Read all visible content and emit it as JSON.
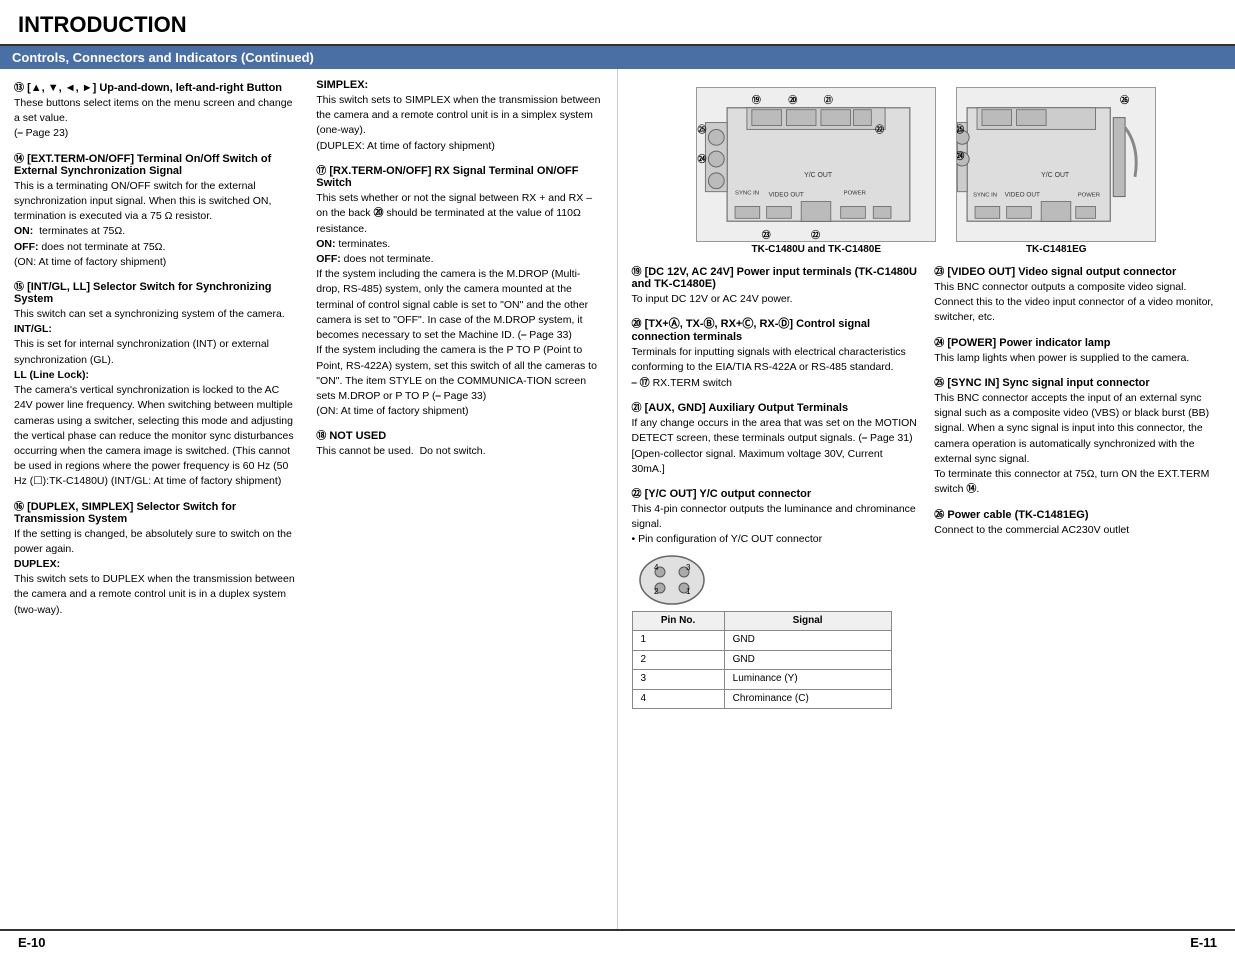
{
  "page": {
    "title": "INTRODUCTION",
    "section_header": "Controls, Connectors and Indicators (Continued)",
    "footer_left": "E-10",
    "footer_right": "E-11"
  },
  "left_column": {
    "entries": [
      {
        "id": "entry_13",
        "num": "⑬",
        "title": "[🔼, 🔽, ◀, ▶] Up-and-down, left-and-right Button",
        "body": "These buttons select items on the menu screen and change a set value.\n(☞ Page 23)"
      },
      {
        "id": "entry_14",
        "num": "⑭",
        "title": "[EXT.TERM-ON/OFF] Terminal On/Off Switch of External Synchronization Signal",
        "body": "This is a terminating ON/OFF switch for the external synchronization input signal. When this is switched ON, termination is executed via a 75 Ω resistor.\nON: terminates at 75Ω.\nOFF: does not terminate at 75Ω.\n(ON: At time of factory shipment)"
      },
      {
        "id": "entry_15",
        "num": "⑮",
        "title": "[INT/GL, LL] Selector Switch for Synchronizing System",
        "body": "This switch can set a synchronizing system of the camera.\nINT/GL:\nThis is set for internal synchronization (INT) or external synchronization (GL).\nLL (Line Lock):\nThe camera's vertical synchronization is locked to the AC 24V power line frequency. When switching between multiple cameras using a switcher, selecting this mode and adjusting the vertical phase can reduce the monitor sync disturbances occurring when the camera image is switched. (This cannot be used in regions where the power frequency is 60 Hz (50 Hz (): TK-C1480U) (INT/GL: At time of factory shipment)"
      },
      {
        "id": "entry_16",
        "num": "⑯",
        "title": "[DUPLEX, SIMPLEX] Selector Switch for Transmission System",
        "body": "If the setting is changed, be absolutely sure to switch on the power again.\nDUPLEX:\nThis switch sets to DUPLEX when the transmission between the camera and a remote control unit is in a duplex system (two-way)."
      }
    ],
    "entries_right_col": [
      {
        "id": "entry_simplex",
        "title": "SIMPLEX:",
        "body": "This switch sets to SIMPLEX when the transmission between the camera and a remote control unit is in a simplex system (one-way).\n(DUPLEX: At time of factory shipment)"
      },
      {
        "id": "entry_17",
        "num": "⑰",
        "title": "[RX.TERM-ON/OFF] RX Signal Terminal ON/OFF Switch",
        "body": "This sets whether or not the signal between RX + and RX – on the back ⑳ should be terminated at the value of 110Ω resistance.\nON: terminates.\nOFF: does not terminate.\nIf the system including the camera is the M.DROP (Multi-drop, RS-485) system, only the camera mounted at the terminal of control signal cable is set to \"ON\" and the other camera is set to \"OFF\". In case of the M.DROP system, it becomes necessary to set the Machine ID. (☞ Page 33)\nIf the system including the camera is the P TO P (Point to Point, RS-422A) system, set this switch of all the cameras to \"ON\". The item STYLE on the COMMUNICA-TION screen sets M.DROP or P TO P (☞ Page 33)\n(ON: At time of factory shipment)"
      },
      {
        "id": "entry_18",
        "num": "⑱",
        "title": "NOT USED",
        "body": "This cannot be used.  Do not switch."
      }
    ]
  },
  "diagrams": {
    "diagram1_label": "TK-C1480U and TK-C1480E",
    "diagram2_label": "TK-C1481EG",
    "callouts": [
      "⑲",
      "⑳",
      "㉑",
      "㉒",
      "㉓",
      "㉔",
      "㉕",
      "㉖"
    ]
  },
  "right_column": {
    "entries": [
      {
        "id": "entry_19",
        "num": "⑲",
        "title": "[DC 12V, AC 24V] Power input terminals (TK-C1480U and TK-C1480E)",
        "body": "To input DC 12V or AC 24V power."
      },
      {
        "id": "entry_20",
        "num": "⑳",
        "title": "[TX+Ⓐ, TX-Ⓑ, RX+Ⓒ, RX-Ⓓ] Control signal connection terminals",
        "body": "Terminals for inputting signals with electrical characteristics conforming to the EIA/TIA RS-422A or RS-485 standard.\n☞ ⑰ RX.TERM switch"
      },
      {
        "id": "entry_21",
        "num": "㉑",
        "title": "[AUX, GND] Auxiliary Output Terminals",
        "body": "If any change occurs in the area that was set on the MOTION DETECT screen, these terminals output signals. (☞ Page 31)\n[Open-collector signal. Maximum voltage 30V, Current 30mA.]"
      },
      {
        "id": "entry_22",
        "num": "㉒",
        "title": "[Y/C OUT] Y/C output connector",
        "body": "This 4-pin connector outputs the luminance and chrominance signal.\n• Pin configuration of Y/C OUT connector"
      },
      {
        "id": "entry_23",
        "num": "㉓",
        "title": "[VIDEO OUT] Video signal output connector",
        "body": "This BNC connector outputs a composite video signal. Connect this to the video input connector of a video monitor, switcher, etc."
      },
      {
        "id": "entry_24",
        "num": "㉔",
        "title": "[POWER] Power indicator lamp",
        "body": "This lamp lights when power is supplied to the camera."
      },
      {
        "id": "entry_25",
        "num": "㉕",
        "title": "[SYNC IN] Sync signal input connector",
        "body": "This BNC connector accepts the input of an external sync signal such as a composite video (VBS) or black burst (BB) signal. When a sync signal is input into this connector, the camera operation is automatically synchronized with the external sync signal.\nTo terminate this connector at 75Ω, turn ON the EXT.TERM switch ⑭."
      },
      {
        "id": "entry_26",
        "num": "㉖",
        "title": "Power cable (TK-C1481EG)",
        "body": "Connect to the commercial AC230V outlet"
      }
    ],
    "pinout_table": {
      "headers": [
        "Pin No.",
        "Signal"
      ],
      "rows": [
        [
          "1",
          "GND"
        ],
        [
          "2",
          "GND"
        ],
        [
          "3",
          "Luminance (Y)"
        ],
        [
          "4",
          "Chrominance (C)"
        ]
      ]
    }
  }
}
